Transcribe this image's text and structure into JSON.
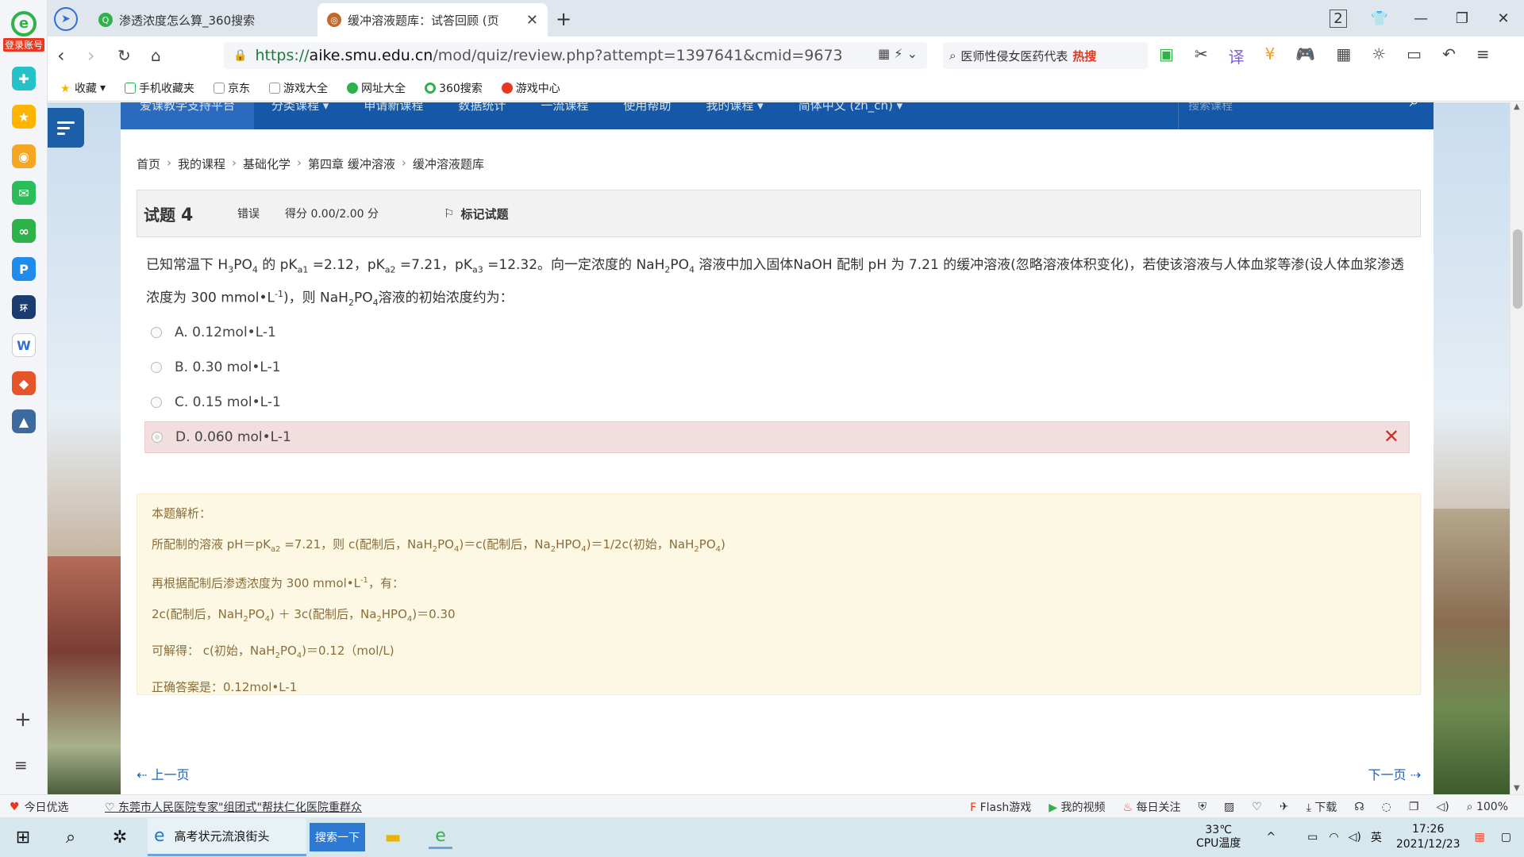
{
  "browser": {
    "tabs": [
      {
        "title": "渗透浓度怎么算_360搜索",
        "active": false
      },
      {
        "title": "缓冲溶液题库：试答回顾 (页",
        "active": true
      }
    ],
    "url_scheme": "https://",
    "url_host": "aike.smu.edu.cn",
    "url_path": "/mod/quiz/review.php?attempt=1397641&cmid=9673",
    "search_placeholder": "医师性侵女医药代表",
    "search_hot": "热搜",
    "tab_counter": "2",
    "bookmarks": [
      "收藏",
      "手机收藏夹",
      "京东",
      "游戏大全",
      "网址大全",
      "360搜索",
      "游戏中心"
    ],
    "login_label": "登录账号"
  },
  "site_nav": {
    "brand": "爱课教学支持平台",
    "items": [
      "分类课程 ▾",
      "申请新课程",
      "数据统计",
      "一流课程",
      "使用帮助",
      "我的课程 ▾",
      "简体中文 (zh_cn) ▾"
    ],
    "search_placeholder": "搜索课程"
  },
  "breadcrumb": [
    "首页",
    "我的课程",
    "基础化学",
    "第四章 缓冲溶液",
    "缓冲溶液题库"
  ],
  "question": {
    "label": "试题",
    "number": "4",
    "state": "错误",
    "grade": "得分 0.00/2.00 分",
    "flag_label": "标记试题",
    "options": [
      {
        "text": "A. 0.12mol•L-1",
        "selected": false
      },
      {
        "text": "B. 0.30 mol•L-1",
        "selected": false
      },
      {
        "text": "C. 0.15 mol•L-1",
        "selected": false
      },
      {
        "text": "D. 0.060 mol•L-1",
        "selected": true,
        "wrong": true
      }
    ]
  },
  "feedback": {
    "title": "本题解析：",
    "answer": "正确答案是：0.12mol•L-1"
  },
  "pager": {
    "prev": "上一页",
    "next": "下一页"
  },
  "statusbar": {
    "left": "今日优选",
    "news": "东莞市人民医院专家\"组团式\"帮扶仁化医院重群众",
    "right": [
      "Flash游戏",
      "我的视频",
      "每日关注",
      "下载",
      "100%"
    ]
  },
  "taskbar": {
    "app_title": "高考状元流浪街头",
    "search_btn": "搜索一下",
    "temp": "33℃",
    "temp_label": "CPU温度",
    "lang": "英",
    "time": "17:26",
    "date": "2021/12/23"
  },
  "colors": {
    "nav_blue": "#1558a7",
    "wrong_bg": "#f2dede",
    "feedback_bg": "#fcf8e3",
    "link": "#1a62b8"
  }
}
